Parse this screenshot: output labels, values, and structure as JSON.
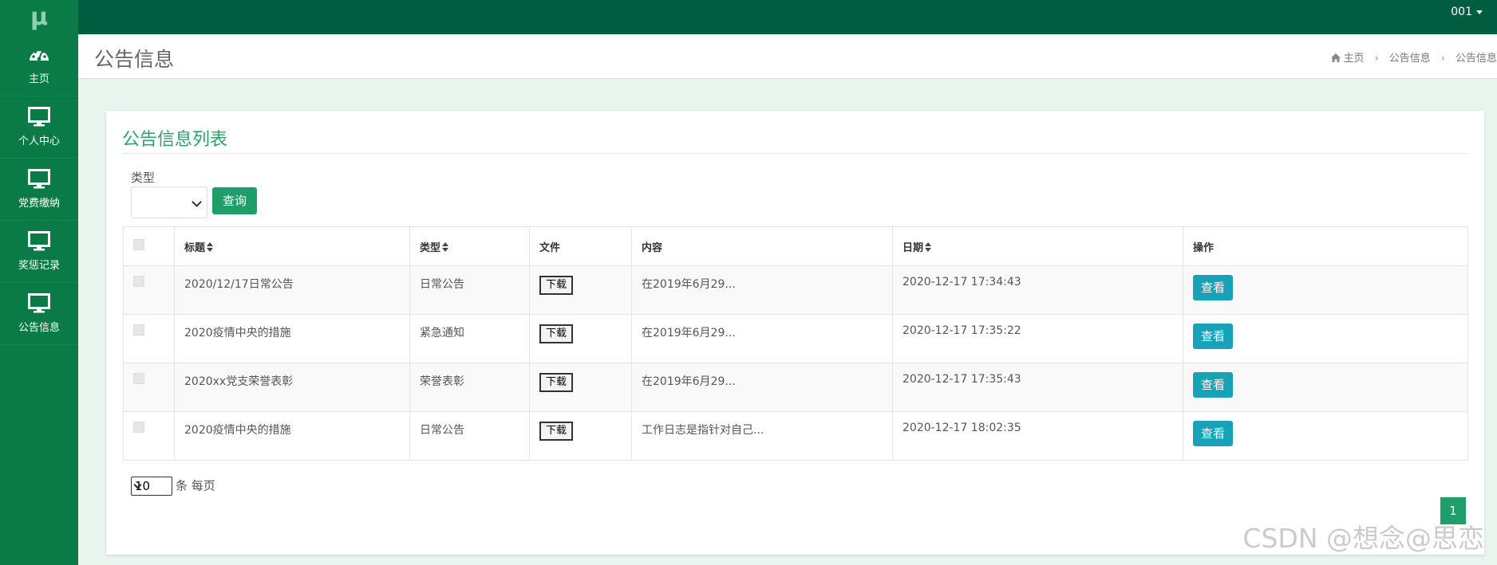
{
  "app": {
    "logo": "μ",
    "user": "001"
  },
  "sidebar": {
    "items": [
      {
        "label": "主页",
        "icon": "dashboard-icon"
      },
      {
        "label": "个人中心",
        "icon": "monitor-icon"
      },
      {
        "label": "党费缴纳",
        "icon": "monitor-icon"
      },
      {
        "label": "奖惩记录",
        "icon": "monitor-icon"
      },
      {
        "label": "公告信息",
        "icon": "monitor-icon"
      }
    ]
  },
  "header": {
    "title": "公告信息",
    "breadcrumb": [
      "主页",
      "公告信息",
      "公告信息"
    ]
  },
  "main": {
    "card_title": "公告信息列表",
    "filter": {
      "label": "类型",
      "value": "",
      "button": "查询"
    },
    "table": {
      "columns": [
        "标题",
        "类型",
        "文件",
        "内容",
        "日期",
        "操作"
      ],
      "rows": [
        {
          "title": "2020/12/17日常公告",
          "type": "日常公告",
          "file": "下载",
          "content": "在2019年6月29...",
          "date": "2020-12-17 17:34:43",
          "action": "查看"
        },
        {
          "title": "2020疫情中央的措施",
          "type": "紧急通知",
          "file": "下载",
          "content": "在2019年6月29...",
          "date": "2020-12-17 17:35:22",
          "action": "查看"
        },
        {
          "title": "2020xx党支荣誉表彰",
          "type": "荣誉表彰",
          "file": "下载",
          "content": "在2019年6月29...",
          "date": "2020-12-17 17:35:43",
          "action": "查看"
        },
        {
          "title": "2020疫情中央的措施",
          "type": "日常公告",
          "file": "下载",
          "content": "工作日志是指针对自己...",
          "date": "2020-12-17 18:02:35",
          "action": "查看"
        }
      ]
    },
    "pagination": {
      "page_size": "10",
      "page_size_suffix": "条 每页",
      "current_page": "1"
    }
  },
  "watermark": "CSDN @想念@思恋",
  "colors": {
    "topbar": "#015d40",
    "sidebar": "#0a7a47",
    "accent": "#1f9e6a",
    "view_button": "#17a2b8"
  }
}
